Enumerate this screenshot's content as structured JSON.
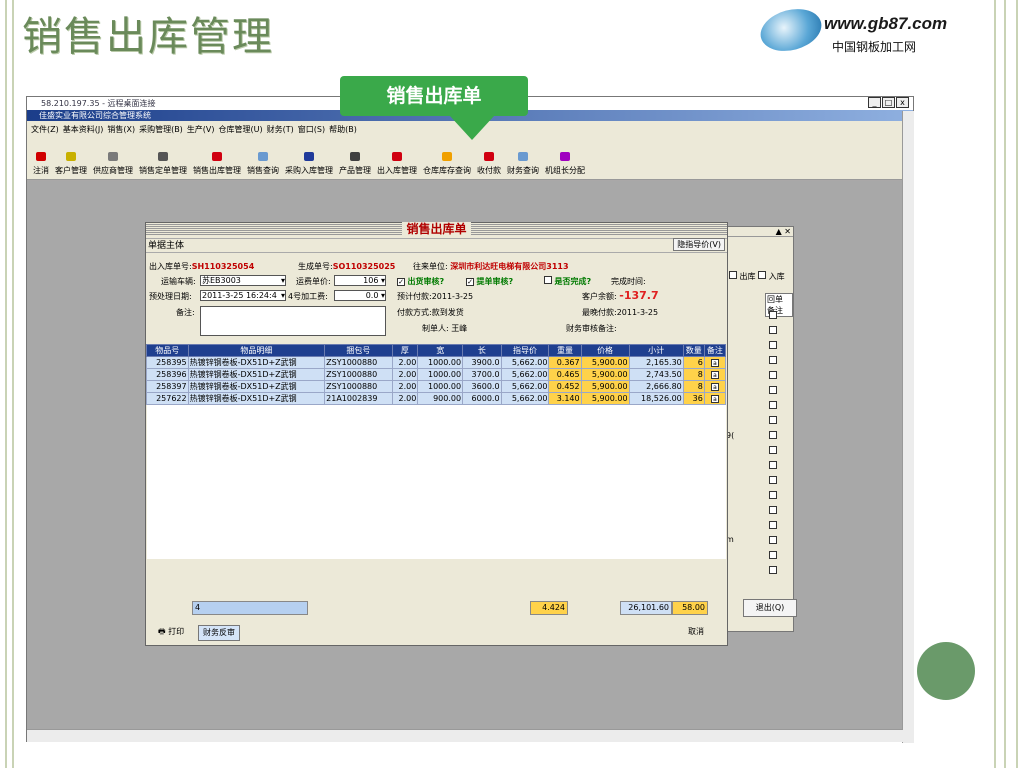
{
  "slide": {
    "title": "销售出库管理",
    "logo_url": "www.gb87.com",
    "logo_cn": "中国钢板加工网",
    "callout": "销售出库单"
  },
  "window": {
    "title": "58.210.197.35 - 远程桌面连接",
    "app_title": "佳盛实业有限公司综合管理系统",
    "controls": [
      "_",
      "□",
      "x"
    ]
  },
  "menu": [
    "文件(Z)",
    "基本资料(J)",
    "销售(X)",
    "采购管理(B)",
    "生产(V)",
    "仓库管理(U)",
    "财务(T)",
    "窗口(S)",
    "帮助(B)"
  ],
  "toolbar": [
    {
      "label": "注消",
      "color": "#d00000"
    },
    {
      "label": "客户管理",
      "color": "#c8b000"
    },
    {
      "label": "供应商管理",
      "color": "#7a7a7a"
    },
    {
      "label": "销售定单管理",
      "color": "#555555"
    },
    {
      "label": "销售出库管理",
      "color": "#d00010"
    },
    {
      "label": "销售查询",
      "color": "#6a9ad0"
    },
    {
      "label": "采购入库管理",
      "color": "#203a9a"
    },
    {
      "label": "产品管理",
      "color": "#404040"
    },
    {
      "label": "出入库管理",
      "color": "#d00010"
    },
    {
      "label": "仓库库存查询",
      "color": "#f0a000"
    },
    {
      "label": "收付款",
      "color": "#d00010"
    },
    {
      "label": "财务查询",
      "color": "#6a9ad0"
    },
    {
      "label": "机组长分配",
      "color": "#a000c0"
    }
  ],
  "bgwin": {
    "chk_out": "出库",
    "chk_in": "入库",
    "col1": "回单",
    "col2": "备注",
    "frag1": "9(",
    "frag2": "m",
    "exit": "退出(Q)"
  },
  "dialog": {
    "title": "销售出库单",
    "section": "单据主体",
    "hide_price": "隐指导价(V)",
    "out_no_label": "出入库单号:",
    "out_no": "SH110325054",
    "gen_no_label": "生成单号:",
    "gen_no": "SO110325025",
    "partner_label": "往来单位:",
    "partner": "深圳市利达旺电梯有限公司3113",
    "vehicle_label": "运输车辆:",
    "vehicle": "苏EB3003",
    "freight_label": "运费单价:",
    "freight": "106",
    "chk_ship": "出货审核?",
    "chk_bill": "提单审核?",
    "chk_done": "是否完成?",
    "done_time": "完成时间:",
    "date_label": "预处理日期:",
    "date": "2011-3-25 16:24:4",
    "proc_label": "4号加工费:",
    "proc": "0.0",
    "plan_pay": "预计付款:2011-3-25",
    "balance_label": "客户余额:",
    "balance": "-137.7",
    "remark_label": "备注:",
    "pay_method": "付款方式:款到发货",
    "latest_pay": "最晚付款:2011-3-25",
    "maker": "制单人: 王峰",
    "fin_remark": "财务审核备注:",
    "columns": [
      "物品号",
      "物品明细",
      "捆包号",
      "厚",
      "宽",
      "长",
      "指导价",
      "重量",
      "价格",
      "小计",
      "数量",
      "备注"
    ],
    "rows": [
      [
        "258395",
        "热镀锌钢卷板-DX51D+Z武钢",
        "ZSY1000880",
        "2.00",
        "1000.00",
        "3900.0",
        "5,662.00",
        "0.367",
        "5,900.00",
        "2,165.30",
        "6"
      ],
      [
        "258396",
        "热镀锌钢卷板-DX51D+Z武钢",
        "ZSY1000880",
        "2.00",
        "1000.00",
        "3700.0",
        "5,662.00",
        "0.465",
        "5,900.00",
        "2,743.50",
        "8"
      ],
      [
        "258397",
        "热镀锌钢卷板-DX51D+Z武钢",
        "ZSY1000880",
        "2.00",
        "1000.00",
        "3600.0",
        "5,662.00",
        "0.452",
        "5,900.00",
        "2,666.80",
        "8"
      ],
      [
        "257622",
        "热镀锌钢卷板-DX51D+Z武钢",
        "21A1002839",
        "2.00",
        "900.00",
        "6000.0",
        "5,662.00",
        "3.140",
        "5,900.00",
        "18,526.00",
        "36"
      ]
    ],
    "sum_count": "4",
    "sum_weight": "4.424",
    "sum_total": "26,101.60",
    "sum_qty": "58.00",
    "print": "打印",
    "reverse": "财务反审",
    "cancel": "取消"
  }
}
